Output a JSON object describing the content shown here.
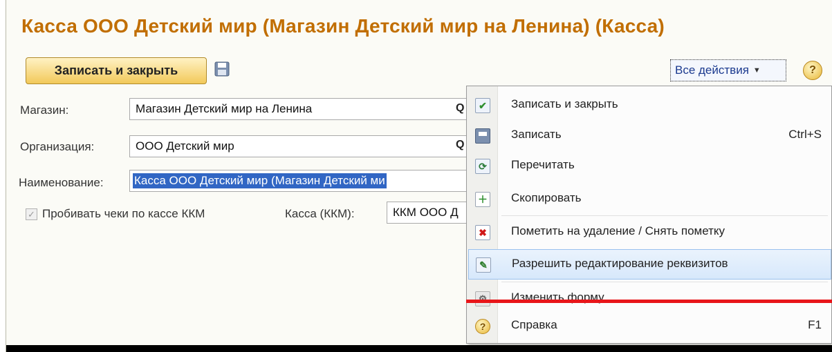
{
  "window": {
    "title": "Касса ООО Детский мир (Магазин Детский мир на Ленина) (Касса)"
  },
  "toolbar": {
    "save_close_label": "Записать и закрыть",
    "all_actions_label": "Все действия",
    "help_label": "?"
  },
  "form": {
    "store_label": "Магазин:",
    "store_value": "Магазин Детский мир на Ленина",
    "org_label": "Организация:",
    "org_value": "ООО Детский мир",
    "name_label": "Наименование:",
    "name_value": "Касса ООО Детский мир (Магазин Детский ми",
    "print_checks_label": "Пробивать чеки по кассе ККМ",
    "print_checks_checked": true,
    "kkm_label": "Касса (ККМ):",
    "kkm_value": "ККМ ООО Д"
  },
  "menu": {
    "items": [
      {
        "label": "Записать и закрыть",
        "shortcut": "",
        "icon": "check-icon"
      },
      {
        "label": "Записать",
        "shortcut": "Ctrl+S",
        "icon": "floppy-icon"
      },
      {
        "label": "Перечитать",
        "shortcut": "",
        "icon": "refresh-icon"
      },
      {
        "label": "Скопировать",
        "shortcut": "",
        "icon": "copy-icon"
      },
      {
        "label": "Пометить на удаление / Снять пометку",
        "shortcut": "",
        "icon": "delete-mark-icon"
      },
      {
        "label": "Разрешить редактирование реквизитов",
        "shortcut": "",
        "icon": "pencil-icon"
      },
      {
        "label": "Изменить форму...",
        "shortcut": "",
        "icon": "gear-icon"
      },
      {
        "label": "Справка",
        "shortcut": "F1",
        "icon": "help-icon"
      }
    ],
    "highlighted_index": 5
  },
  "colors": {
    "title": "#c16e00",
    "accent_red": "#e8161a",
    "selection": "#3166c4"
  }
}
